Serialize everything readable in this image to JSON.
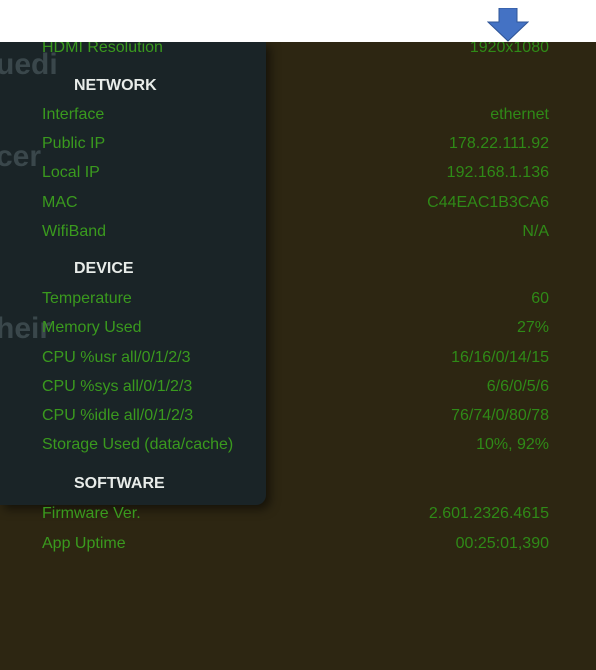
{
  "colors": {
    "screen_bg": "#2d2612",
    "panel_bg": "#1a2427",
    "label_green": "#3a9a1e",
    "value_green": "#2f8a17",
    "section_title": "#e8ece9",
    "arrow_blue": "#4472c4"
  },
  "icons": {
    "pointer": "down-arrow-icon"
  },
  "ghost_text": [
    "uedi",
    "cer",
    "heir"
  ],
  "top_partial": {
    "label": "HDMI Resolution",
    "value": "1920x1080"
  },
  "network": {
    "title": "NETWORK",
    "rows": [
      {
        "label": "Interface",
        "value": "ethernet"
      },
      {
        "label": "Public IP",
        "value": "178.22.111.92"
      },
      {
        "label": "Local IP",
        "value": "192.168.1.136"
      },
      {
        "label": "MAC",
        "value": "C44EAC1B3CA6"
      },
      {
        "label": "WifiBand",
        "value": "N/A"
      }
    ]
  },
  "device": {
    "title": "DEVICE",
    "rows": [
      {
        "label": "Temperature",
        "value": "60"
      },
      {
        "label": "Memory Used",
        "value": "27%"
      },
      {
        "label": "CPU %usr all/0/1/2/3",
        "value": "16/16/0/14/15"
      },
      {
        "label": "CPU %sys all/0/1/2/3",
        "value": "6/6/0/5/6"
      },
      {
        "label": "CPU %idle all/0/1/2/3",
        "value": "76/74/0/80/78"
      },
      {
        "label": "Storage Used (data/cache)",
        "value": "10%, 92%"
      }
    ]
  },
  "software": {
    "title": "SOFTWARE",
    "rows": [
      {
        "label": "Firmware Ver.",
        "value": "2.601.2326.4615"
      },
      {
        "label": "App Uptime",
        "value": "00:25:01,390"
      }
    ]
  }
}
